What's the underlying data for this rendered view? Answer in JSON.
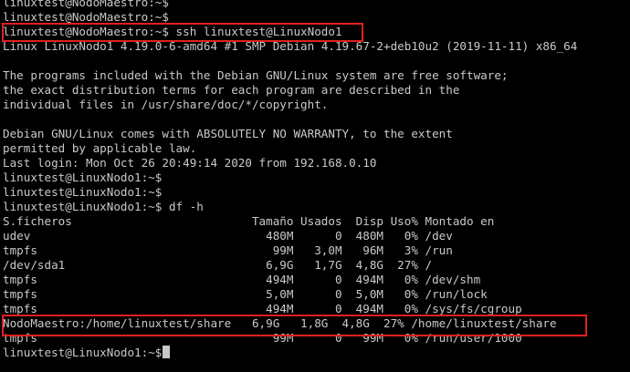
{
  "terminal": {
    "lines": [
      "linuxtest@NodoMaestro:~$",
      "linuxtest@NodoMaestro:~$",
      "linuxtest@NodoMaestro:~$ ssh linuxtest@LinuxNodo1",
      "Linux LinuxNodo1 4.19.0-6-amd64 #1 SMP Debian 4.19.67-2+deb10u2 (2019-11-11) x86_64",
      "",
      "The programs included with the Debian GNU/Linux system are free software;",
      "the exact distribution terms for each program are described in the",
      "individual files in /usr/share/doc/*/copyright.",
      "",
      "Debian GNU/Linux comes with ABSOLUTELY NO WARRANTY, to the extent",
      "permitted by applicable law.",
      "Last login: Mon Oct 26 20:49:14 2020 from 192.168.0.10",
      "linuxtest@LinuxNodo1:~$",
      "linuxtest@LinuxNodo1:~$",
      "linuxtest@LinuxNodo1:~$ df -h",
      "S.ficheros                          Tamaño Usados  Disp Uso% Montado en",
      "udev                                  480M      0  480M   0% /dev",
      "tmpfs                                  99M   3,0M   96M   3% /run",
      "/dev/sda1                             6,9G   1,7G  4,8G  27% /",
      "tmpfs                                 494M      0  494M   0% /dev/shm",
      "tmpfs                                 5,0M      0  5,0M   0% /run/lock",
      "tmpfs                                 494M      0  494M   0% /sys/fs/cgroup",
      "NodoMaestro:/home/linuxtest/share   6,9G   1,8G  4,8G  27% /home/linuxtest/share",
      "tmpfs                                  99M      0   99M   0% /run/user/1000",
      "linuxtest@LinuxNodo1:~$"
    ]
  },
  "colors": {
    "background": "#000000",
    "text": "#c9c9c9",
    "highlight": "#e02020"
  }
}
